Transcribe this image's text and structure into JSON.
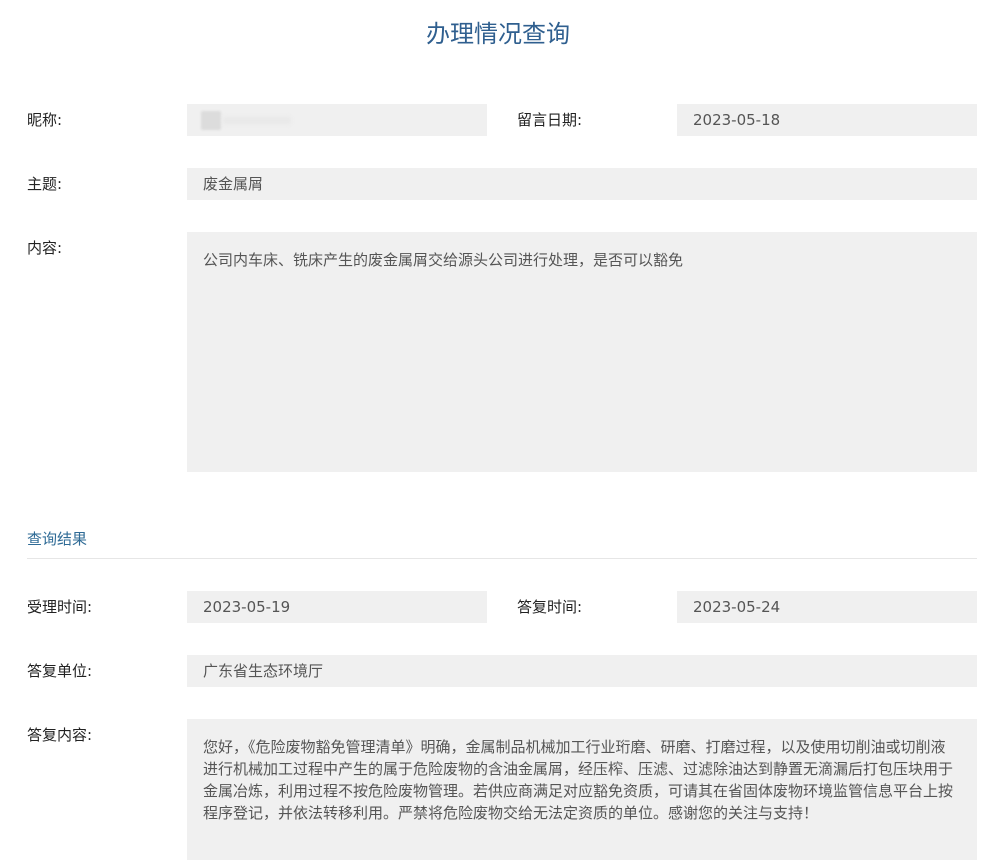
{
  "page_title": "办理情况查询",
  "labels": {
    "nickname": "昵称:",
    "message_date": "留言日期:",
    "subject": "主题:",
    "content": "内容:",
    "accept_time": "受理时间:",
    "reply_time": "答复时间:",
    "reply_unit": "答复单位:",
    "reply_content": "答复内容:"
  },
  "values": {
    "message_date": "2023-05-18",
    "subject": "废金属屑",
    "content": "公司内车床、铣床产生的废金属屑交给源头公司进行处理，是否可以豁免",
    "accept_time": "2023-05-19",
    "reply_time": "2023-05-24",
    "reply_unit": "广东省生态环境厅",
    "reply_content": "您好，《危险废物豁免管理清单》明确，金属制品机械加工行业珩磨、研磨、打磨过程，以及使用切削油或切削液进行机械加工过程中产生的属于危险废物的含油金属屑，经压榨、压滤、过滤除油达到静置无滴漏后打包压块用于金属冶炼，利用过程不按危险废物管理。若供应商满足对应豁免资质，可请其在省固体废物环境监管信息平台上按程序登记，并依法转移利用。严禁将危险废物交给无法定资质的单位。感谢您的关注与支持！"
  },
  "section_title": "查询结果"
}
